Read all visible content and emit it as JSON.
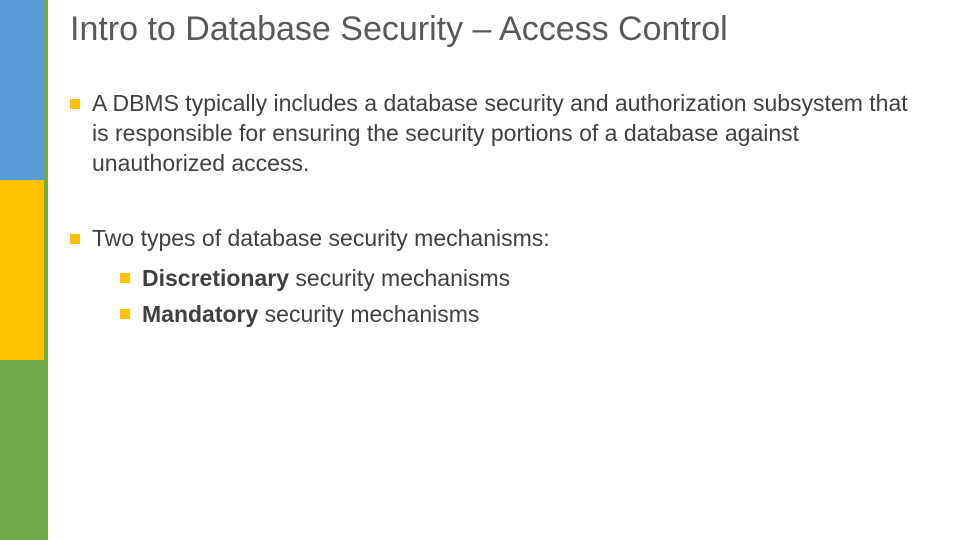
{
  "title": "Intro to Database Security – Access Control",
  "bullets": [
    {
      "text": "A DBMS typically includes a database security and authorization subsystem that is responsible for ensuring the security portions of a database against unauthorized access."
    },
    {
      "text": "Two types of database security mechanisms:",
      "children": [
        {
          "bold": "Discretionary",
          "rest": " security mechanisms"
        },
        {
          "bold": "Mandatory",
          "rest": " security mechanisms"
        }
      ]
    }
  ]
}
